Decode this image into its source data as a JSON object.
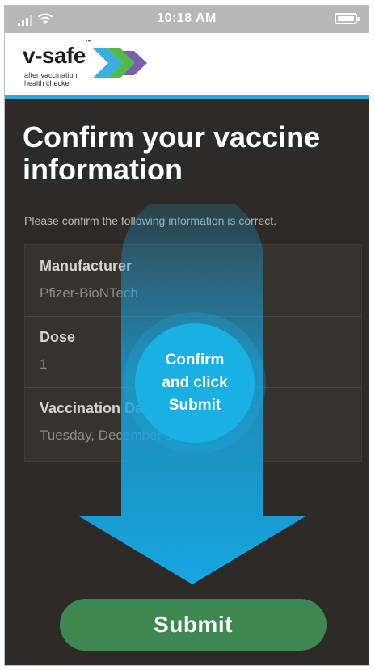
{
  "status_bar": {
    "time": "10:18 AM"
  },
  "brand": {
    "name": "v-safe",
    "trademark": "™",
    "tagline_line1": "after vaccination",
    "tagline_line2": "health checker"
  },
  "page": {
    "title": "Confirm your vaccine information",
    "subtitle": "Please confirm the following information is correct."
  },
  "fields": [
    {
      "label": "Manufacturer",
      "value": "Pfizer-BioNTech"
    },
    {
      "label": "Dose",
      "value": "1"
    },
    {
      "label": "Vaccination Date",
      "value": "Tuesday, December 15, 2020"
    }
  ],
  "callout": {
    "text_line1": "Confirm",
    "text_line2": "and click",
    "text_line3": "Submit"
  },
  "submit_label": "Submit",
  "colors": {
    "header_accent": "#2ea7df",
    "callout": "#1bb0e3",
    "submit": "#3f8751",
    "background": "#2d2a27"
  }
}
